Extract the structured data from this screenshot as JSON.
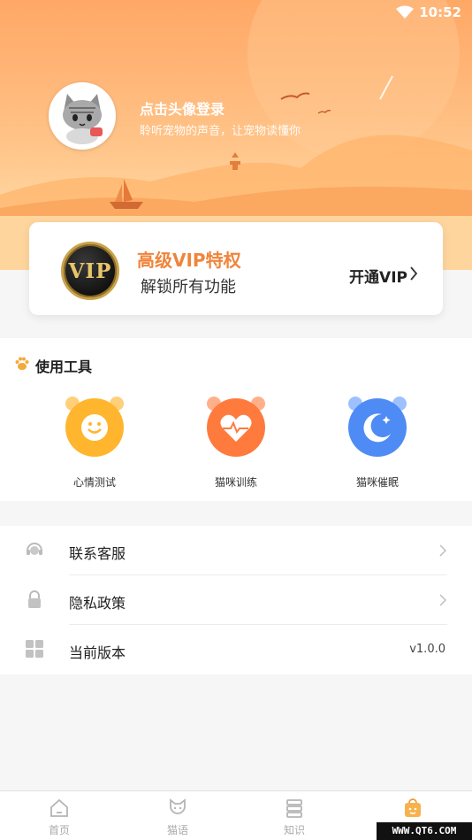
{
  "status_bar": {
    "time": "10:52",
    "wifi_icon": "wifi-icon"
  },
  "profile": {
    "login_title": "点击头像登录",
    "login_subtitle": "聆听宠物的声音，让宠物读懂你",
    "avatar_icon": "cat-avatar"
  },
  "vip": {
    "badge_text": "VIP",
    "title": "高级VIP特权",
    "subtitle": "解锁所有功能",
    "action_label": "开通VIP",
    "accent_color": "#f0843a"
  },
  "tools": {
    "title": "使用工具",
    "header_icon": "paw-icon",
    "items": [
      {
        "label": "心情测试",
        "icon": "smile-icon",
        "color": "#ffb52e"
      },
      {
        "label": "猫咪训练",
        "icon": "heart-pulse-icon",
        "color": "#ff7a3d"
      },
      {
        "label": "猫咪催眠",
        "icon": "moon-icon",
        "color": "#4e8bf5"
      }
    ]
  },
  "settings": {
    "items": [
      {
        "label": "联系客服",
        "icon": "headset-icon",
        "value": ""
      },
      {
        "label": "隐私政策",
        "icon": "lock-icon",
        "value": ""
      },
      {
        "label": "当前版本",
        "icon": "grid-icon",
        "value": "v1.0.0"
      }
    ]
  },
  "tabbar": {
    "items": [
      {
        "label": "首页",
        "icon": "home-icon",
        "active": false
      },
      {
        "label": "猫语",
        "icon": "cat-face-icon",
        "active": false
      },
      {
        "label": "知识",
        "icon": "books-icon",
        "active": false
      },
      {
        "label": "",
        "icon": "bag-icon",
        "active": true
      }
    ],
    "active_color": "#f29a38"
  },
  "watermark": "WWW.QT6.COM"
}
